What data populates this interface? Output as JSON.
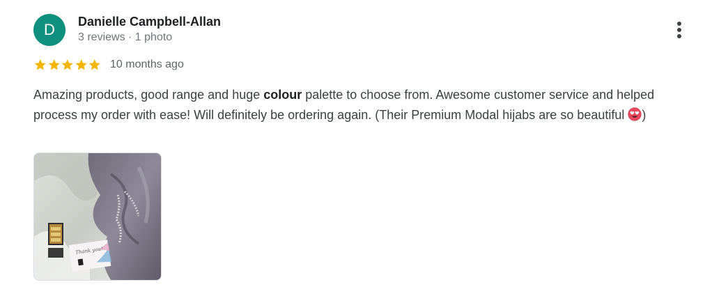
{
  "review": {
    "author_initial": "D",
    "author_name": "Danielle Campbell-Allan",
    "author_meta": "3 reviews · 1 photo",
    "rating": 5,
    "rating_max": 5,
    "time_ago": "10 months ago",
    "text_part1": "Amazing products, good range and huge ",
    "text_bold": "colour",
    "text_part2": " palette to choose from. Awesome customer service and helped process my order with ease! Will definitely be ordering again. (Their Premium Modal hijabs are so beautiful ",
    "text_part3": ")",
    "emoji_icon": "heart-eyes-emoji-icon",
    "photo": {
      "card_text": "Thank you!"
    }
  },
  "colors": {
    "avatar_bg": "#0f8f7e",
    "star": "#f4b400",
    "text": "#3c4043",
    "meta": "#70757a"
  }
}
